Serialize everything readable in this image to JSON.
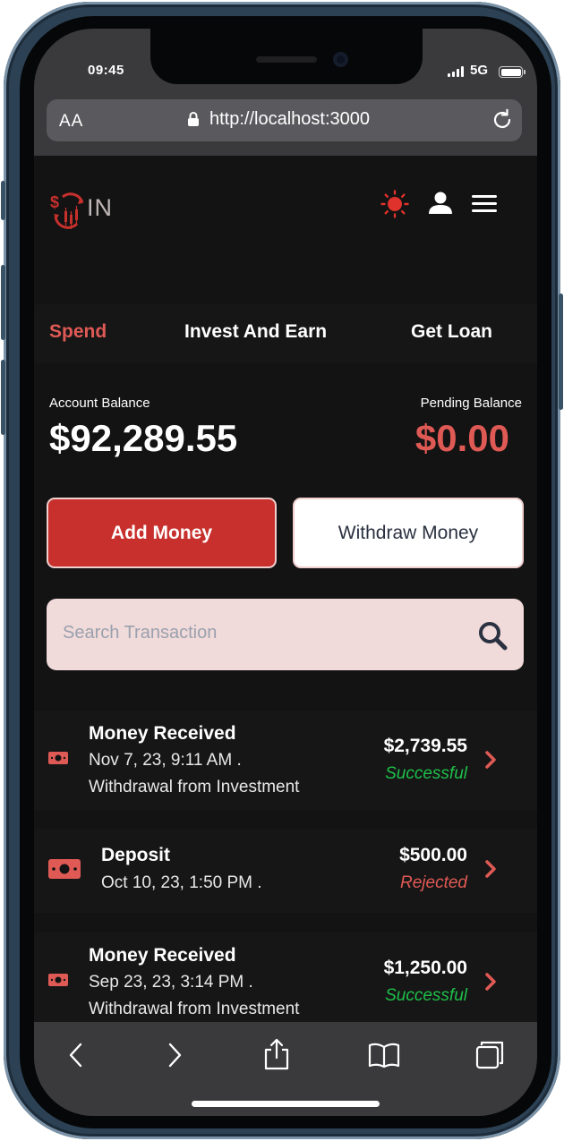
{
  "status_bar": {
    "time": "09:45",
    "network": "5G"
  },
  "browser": {
    "text_size_label": "AA",
    "url": "http://localhost:3000"
  },
  "brand": {
    "logo_text": "IN"
  },
  "tabs": [
    {
      "label": "Spend",
      "active": true
    },
    {
      "label": "Invest And Earn",
      "active": false
    },
    {
      "label": "Get Loan",
      "active": false
    }
  ],
  "balances": {
    "account_label": "Account Balance",
    "account_value": "$92,289.55",
    "pending_label": "Pending Balance",
    "pending_value": "$0.00"
  },
  "actions": {
    "add_money": "Add Money",
    "withdraw_money": "Withdraw Money"
  },
  "search": {
    "placeholder": "Search Transaction"
  },
  "transactions": [
    {
      "title": "Money Received",
      "date": "Nov 7, 23, 9:11 AM .",
      "description": "Withdrawal from Investment",
      "amount": "$2,739.55",
      "status": "Successful"
    },
    {
      "title": "Deposit",
      "date": "Oct 10, 23, 1:50 PM .",
      "description": "",
      "amount": "$500.00",
      "status": "Rejected"
    },
    {
      "title": "Money Received",
      "date": "Sep 23, 23, 3:14 PM .",
      "description": "Withdrawal from Investment",
      "amount": "$1,250.00",
      "status": "Successful"
    }
  ],
  "colors": {
    "accent": "#c7302c",
    "accent_text": "#e05a55",
    "success": "#1fbf4a",
    "rejected": "#e05a55",
    "background": "#131313"
  },
  "icons": {
    "logo": "coin-exchange-logo",
    "theme": "sun-icon",
    "profile": "user-icon",
    "menu": "hamburger-menu-icon",
    "search": "search-icon",
    "transaction": "banknote-icon",
    "row_action": "chevron-right-icon"
  }
}
